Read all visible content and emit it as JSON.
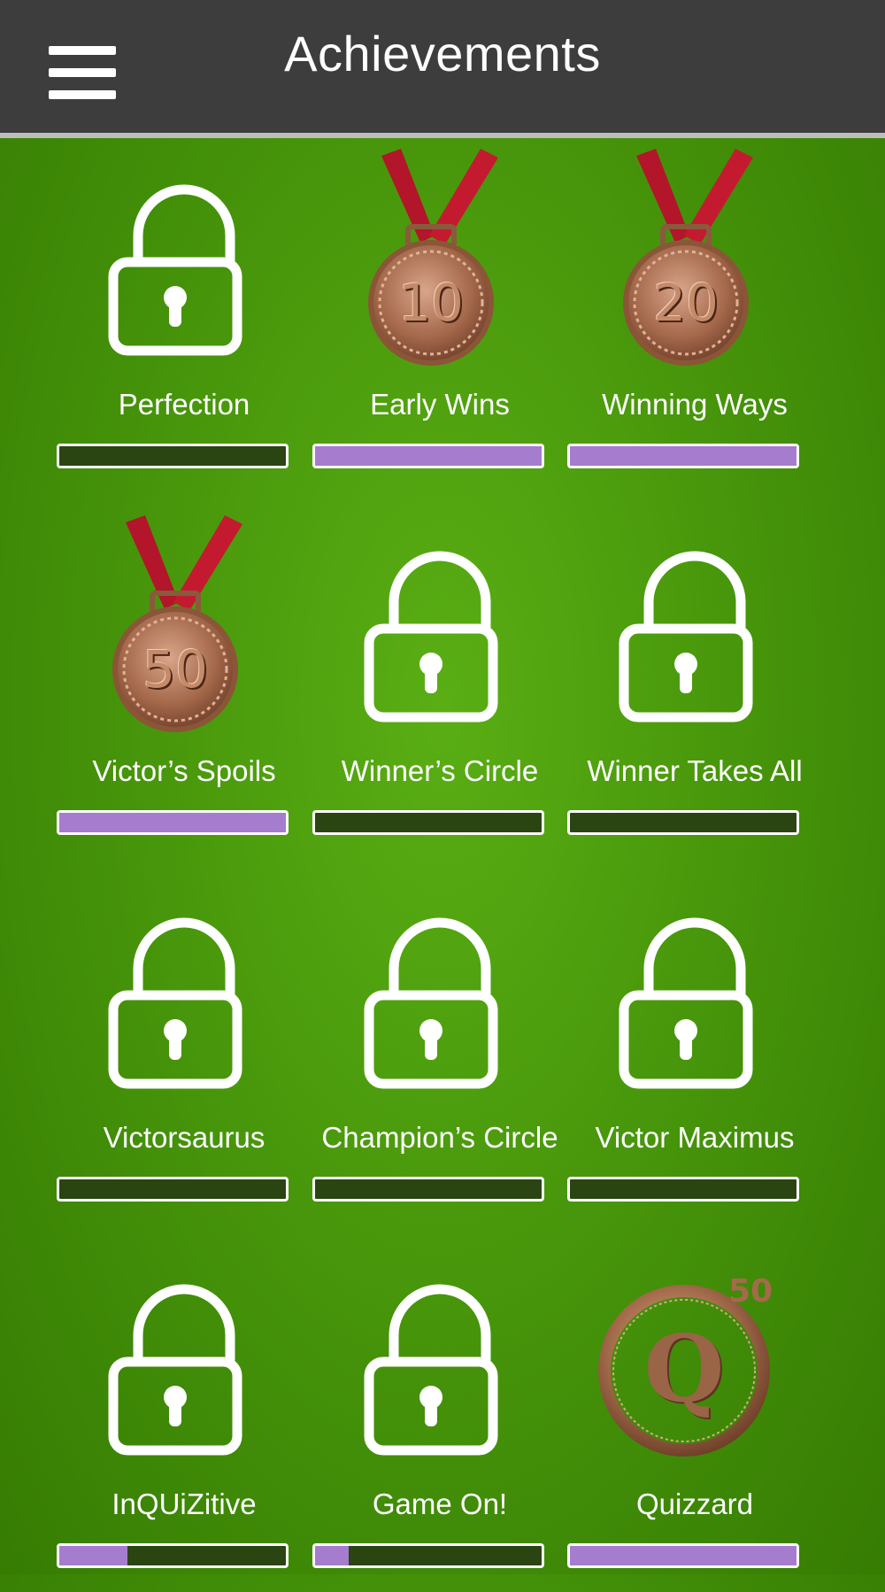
{
  "header": {
    "title": "Achievements",
    "menu_icon": "hamburger-menu-icon"
  },
  "colors": {
    "header_bg": "#3d3d3d",
    "progress_fill": "#a57cce",
    "progress_track": "#2a4512",
    "background": "#4e9f0e"
  },
  "achievements": [
    {
      "label": "Perfection",
      "icon": "lock-icon",
      "progress": 0
    },
    {
      "label": "Early Wins",
      "icon": "bronze-medal-10-icon",
      "badge_text": "10",
      "progress": 1
    },
    {
      "label": "Winning Ways",
      "icon": "bronze-medal-20-icon",
      "badge_text": "20",
      "progress": 1
    },
    {
      "label": "Victor’s Spoils",
      "icon": "bronze-medal-50-icon",
      "badge_text": "50",
      "progress": 1
    },
    {
      "label": "Winner’s Circle",
      "icon": "lock-icon",
      "progress": 0
    },
    {
      "label": "Winner Takes All",
      "icon": "lock-icon",
      "progress": 0
    },
    {
      "label": "Victorsaurus",
      "icon": "lock-icon",
      "progress": 0
    },
    {
      "label": "Champion’s Circle",
      "icon": "lock-icon",
      "progress": 0
    },
    {
      "label": "Victor Maximus",
      "icon": "lock-icon",
      "progress": 0
    },
    {
      "label": "InQUiZitive",
      "icon": "lock-icon",
      "progress": 0.3
    },
    {
      "label": "Game On!",
      "icon": "lock-icon",
      "progress": 0.15
    },
    {
      "label": "Quizzard",
      "icon": "quizzard-q-50-badge-icon",
      "badge_text": "Q",
      "badge_sup": "50",
      "progress": 1
    }
  ]
}
